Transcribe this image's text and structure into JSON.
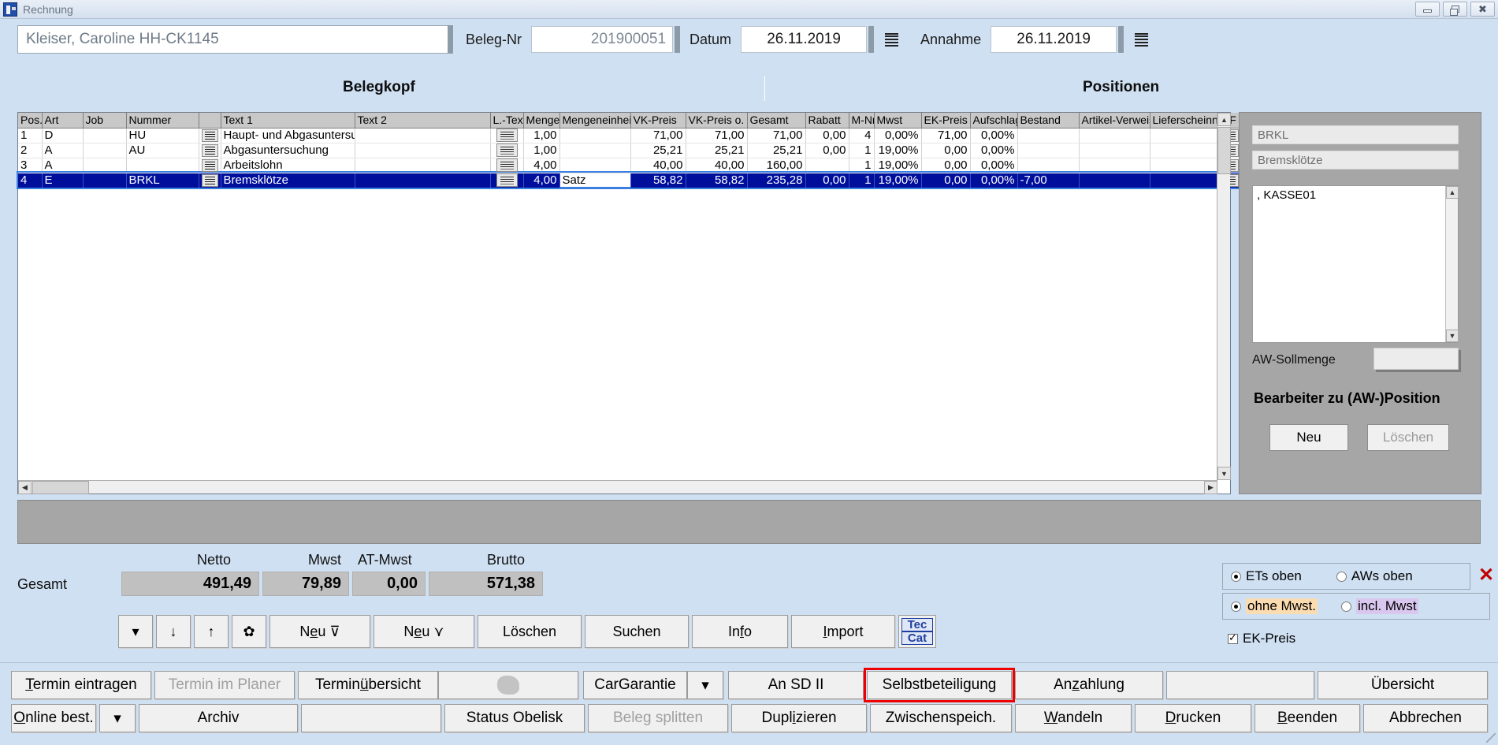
{
  "window": {
    "title": "Rechnung",
    "minimize": "minimize-icon",
    "restore": "restore-icon",
    "close": "close-icon"
  },
  "header": {
    "customer": "Kleiser, Caroline HH-CK1145",
    "beleg_nr_label": "Beleg-Nr",
    "beleg_nr_value": "201900051",
    "datum_label": "Datum",
    "datum_value": "26.11.2019",
    "annahme_label": "Annahme",
    "annahme_value": "26.11.2019"
  },
  "sections": {
    "left": "Belegkopf",
    "right": "Positionen"
  },
  "grid": {
    "columns": [
      "Pos.",
      "Art",
      "Job",
      "Nummer",
      "",
      "Text 1",
      "Text 2",
      "L.-Text",
      "Menge",
      "Mengeneinheit",
      "VK-Preis",
      "VK-Preis o.",
      "Gesamt",
      "Rabatt",
      "M-Nr",
      "Mwst",
      "EK-Preis",
      "Aufschlag",
      "Bestand",
      "Artikel-Verweise",
      "Lieferscheinnr.",
      "LF"
    ],
    "rows": [
      {
        "pos": "1",
        "art": "D",
        "job": "",
        "nummer": "HU",
        "text1": "Haupt- und Abgasuntersuchu",
        "text2": "",
        "menge": "1,00",
        "mengeneinheit": "",
        "vk_preis": "71,00",
        "vk_preis_o": "71,00",
        "gesamt": "71,00",
        "rabatt": "0,00",
        "m_nr": "4",
        "mwst": "0,00%",
        "ek_preis": "71,00",
        "aufschlag": "0,00%",
        "bestand": "",
        "artikel_verweise": "",
        "lieferscheinnr": "",
        "selected": false
      },
      {
        "pos": "2",
        "art": "A",
        "job": "",
        "nummer": "AU",
        "text1": "Abgasuntersuchung",
        "text2": "",
        "menge": "1,00",
        "mengeneinheit": "",
        "vk_preis": "25,21",
        "vk_preis_o": "25,21",
        "gesamt": "25,21",
        "rabatt": "0,00",
        "m_nr": "1",
        "mwst": "19,00%",
        "ek_preis": "0,00",
        "aufschlag": "0,00%",
        "bestand": "",
        "artikel_verweise": "",
        "lieferscheinnr": "",
        "selected": false
      },
      {
        "pos": "3",
        "art": "A",
        "job": "",
        "nummer": "",
        "text1": "Arbeitslohn",
        "text2": "",
        "menge": "4,00",
        "mengeneinheit": "",
        "vk_preis": "40,00",
        "vk_preis_o": "40,00",
        "gesamt": "160,00",
        "rabatt": "",
        "m_nr": "1",
        "mwst": "19,00%",
        "ek_preis": "0,00",
        "aufschlag": "0,00%",
        "bestand": "",
        "artikel_verweise": "",
        "lieferscheinnr": "",
        "selected": false
      },
      {
        "pos": "4",
        "art": "E",
        "job": "",
        "nummer": "BRKL",
        "text1": "Bremsklötze",
        "text2": "",
        "menge": "4,00",
        "mengeneinheit": "Satz",
        "vk_preis": "58,82",
        "vk_preis_o": "58,82",
        "gesamt": "235,28",
        "rabatt": "0,00",
        "m_nr": "1",
        "mwst": "19,00%",
        "ek_preis": "0,00",
        "aufschlag": "0,00%",
        "bestand": "-7,00",
        "artikel_verweise": "",
        "lieferscheinnr": "",
        "selected": true
      }
    ]
  },
  "position_panel": {
    "article_number": "BRKL",
    "article_text": "Bremsklötze",
    "list_entry": ", KASSE01",
    "aw_sollmenge_label": "AW-Sollmenge",
    "aw_sollmenge_value": "",
    "bearbeiter_title": "Bearbeiter zu (AW-)Position",
    "new_button": "Neu",
    "delete_button": "Löschen"
  },
  "totals": {
    "row_label": "Gesamt",
    "netto_label": "Netto",
    "netto_value": "491,49",
    "mwst_label": "Mwst",
    "mwst_value": "79,89",
    "at_mwst_label": "AT-Mwst",
    "at_mwst_value": "0,00",
    "brutto_label": "Brutto",
    "brutto_value": "571,38"
  },
  "mid_toolbar": [
    {
      "name": "dropdown",
      "label": "▾"
    },
    {
      "name": "move-down",
      "label": "↓"
    },
    {
      "name": "move-up",
      "label": "↑"
    },
    {
      "name": "settings",
      "label": "✿"
    },
    {
      "name": "neu-down",
      "label": "Neu ⊽",
      "accel": "e"
    },
    {
      "name": "neu-up",
      "label": "Neu ⋎",
      "accel": "e"
    },
    {
      "name": "loeschen",
      "label": "Löschen"
    },
    {
      "name": "suchen",
      "label": "Suchen"
    },
    {
      "name": "info",
      "label": "Info",
      "accel": "f"
    },
    {
      "name": "import",
      "label": "Import",
      "accel": "I"
    },
    {
      "name": "teccat",
      "label": "Tec Cat"
    }
  ],
  "options": {
    "ets_oben": "ETs oben",
    "aws_oben": "AWs oben",
    "ets_oben_selected": true,
    "ohne_mwst": "ohne Mwst.",
    "incl_mwst": "incl. Mwst",
    "ohne_mwst_selected": true,
    "ek_preis": "EK-Preis",
    "ek_preis_checked": true,
    "close_x": "✕"
  },
  "bottom_buttons_row1": [
    {
      "label": "Termin eintragen",
      "name": "termin-eintragen",
      "disabled": false,
      "accel": "T"
    },
    {
      "label": "Termin im Planer",
      "name": "termin-im-planer",
      "disabled": true
    },
    {
      "label": "Terminübersicht",
      "name": "terminuebersicht",
      "disabled": false,
      "accel": "ü"
    },
    {
      "label": "",
      "name": "image-button",
      "disabled": false
    },
    {
      "label": "CarGarantie",
      "name": "cargarantie",
      "disabled": false
    },
    {
      "label": "▾",
      "name": "cargarantie-dropdown",
      "disabled": false
    },
    {
      "label": "An SD II",
      "name": "an-sd-ii",
      "disabled": false
    },
    {
      "label": "Selbstbeteiligung",
      "name": "selbstbeteiligung",
      "disabled": false,
      "highlighted": true
    },
    {
      "label": "Anzahlung",
      "name": "anzahlung",
      "disabled": false,
      "accel": "z"
    },
    {
      "label": "",
      "name": "empty-button-1",
      "disabled": false
    },
    {
      "label": "Übersicht",
      "name": "uebersicht",
      "disabled": false
    }
  ],
  "bottom_buttons_row2": [
    {
      "label": "Online best.",
      "name": "online-best",
      "disabled": false,
      "accel": "O"
    },
    {
      "label": "▾",
      "name": "online-best-dropdown",
      "disabled": false
    },
    {
      "label": "Archiv",
      "name": "archiv",
      "disabled": false
    },
    {
      "label": "",
      "name": "empty-button-2",
      "disabled": false
    },
    {
      "label": "Status Obelisk",
      "name": "status-obelisk",
      "disabled": false
    },
    {
      "label": "Beleg splitten",
      "name": "beleg-splitten",
      "disabled": true
    },
    {
      "label": "Duplizieren",
      "name": "duplizieren",
      "disabled": false,
      "accel": "i"
    },
    {
      "label": "Zwischenspeich.",
      "name": "zwischenspeichern",
      "disabled": false
    },
    {
      "label": "Wandeln",
      "name": "wandeln",
      "disabled": false,
      "accel": "W"
    },
    {
      "label": "Drucken",
      "name": "drucken",
      "disabled": false,
      "accel": "D"
    },
    {
      "label": "Beenden",
      "name": "beenden",
      "disabled": false,
      "accel": "B"
    },
    {
      "label": "Abbrechen",
      "name": "abbrechen",
      "disabled": false
    }
  ],
  "colors": {
    "background": "#cfe0f2",
    "selected_row": "#000f9b",
    "grid_header": "#c8c8c8",
    "panel_gray": "#a6a6a6",
    "highlight_red": "#ee0000"
  }
}
